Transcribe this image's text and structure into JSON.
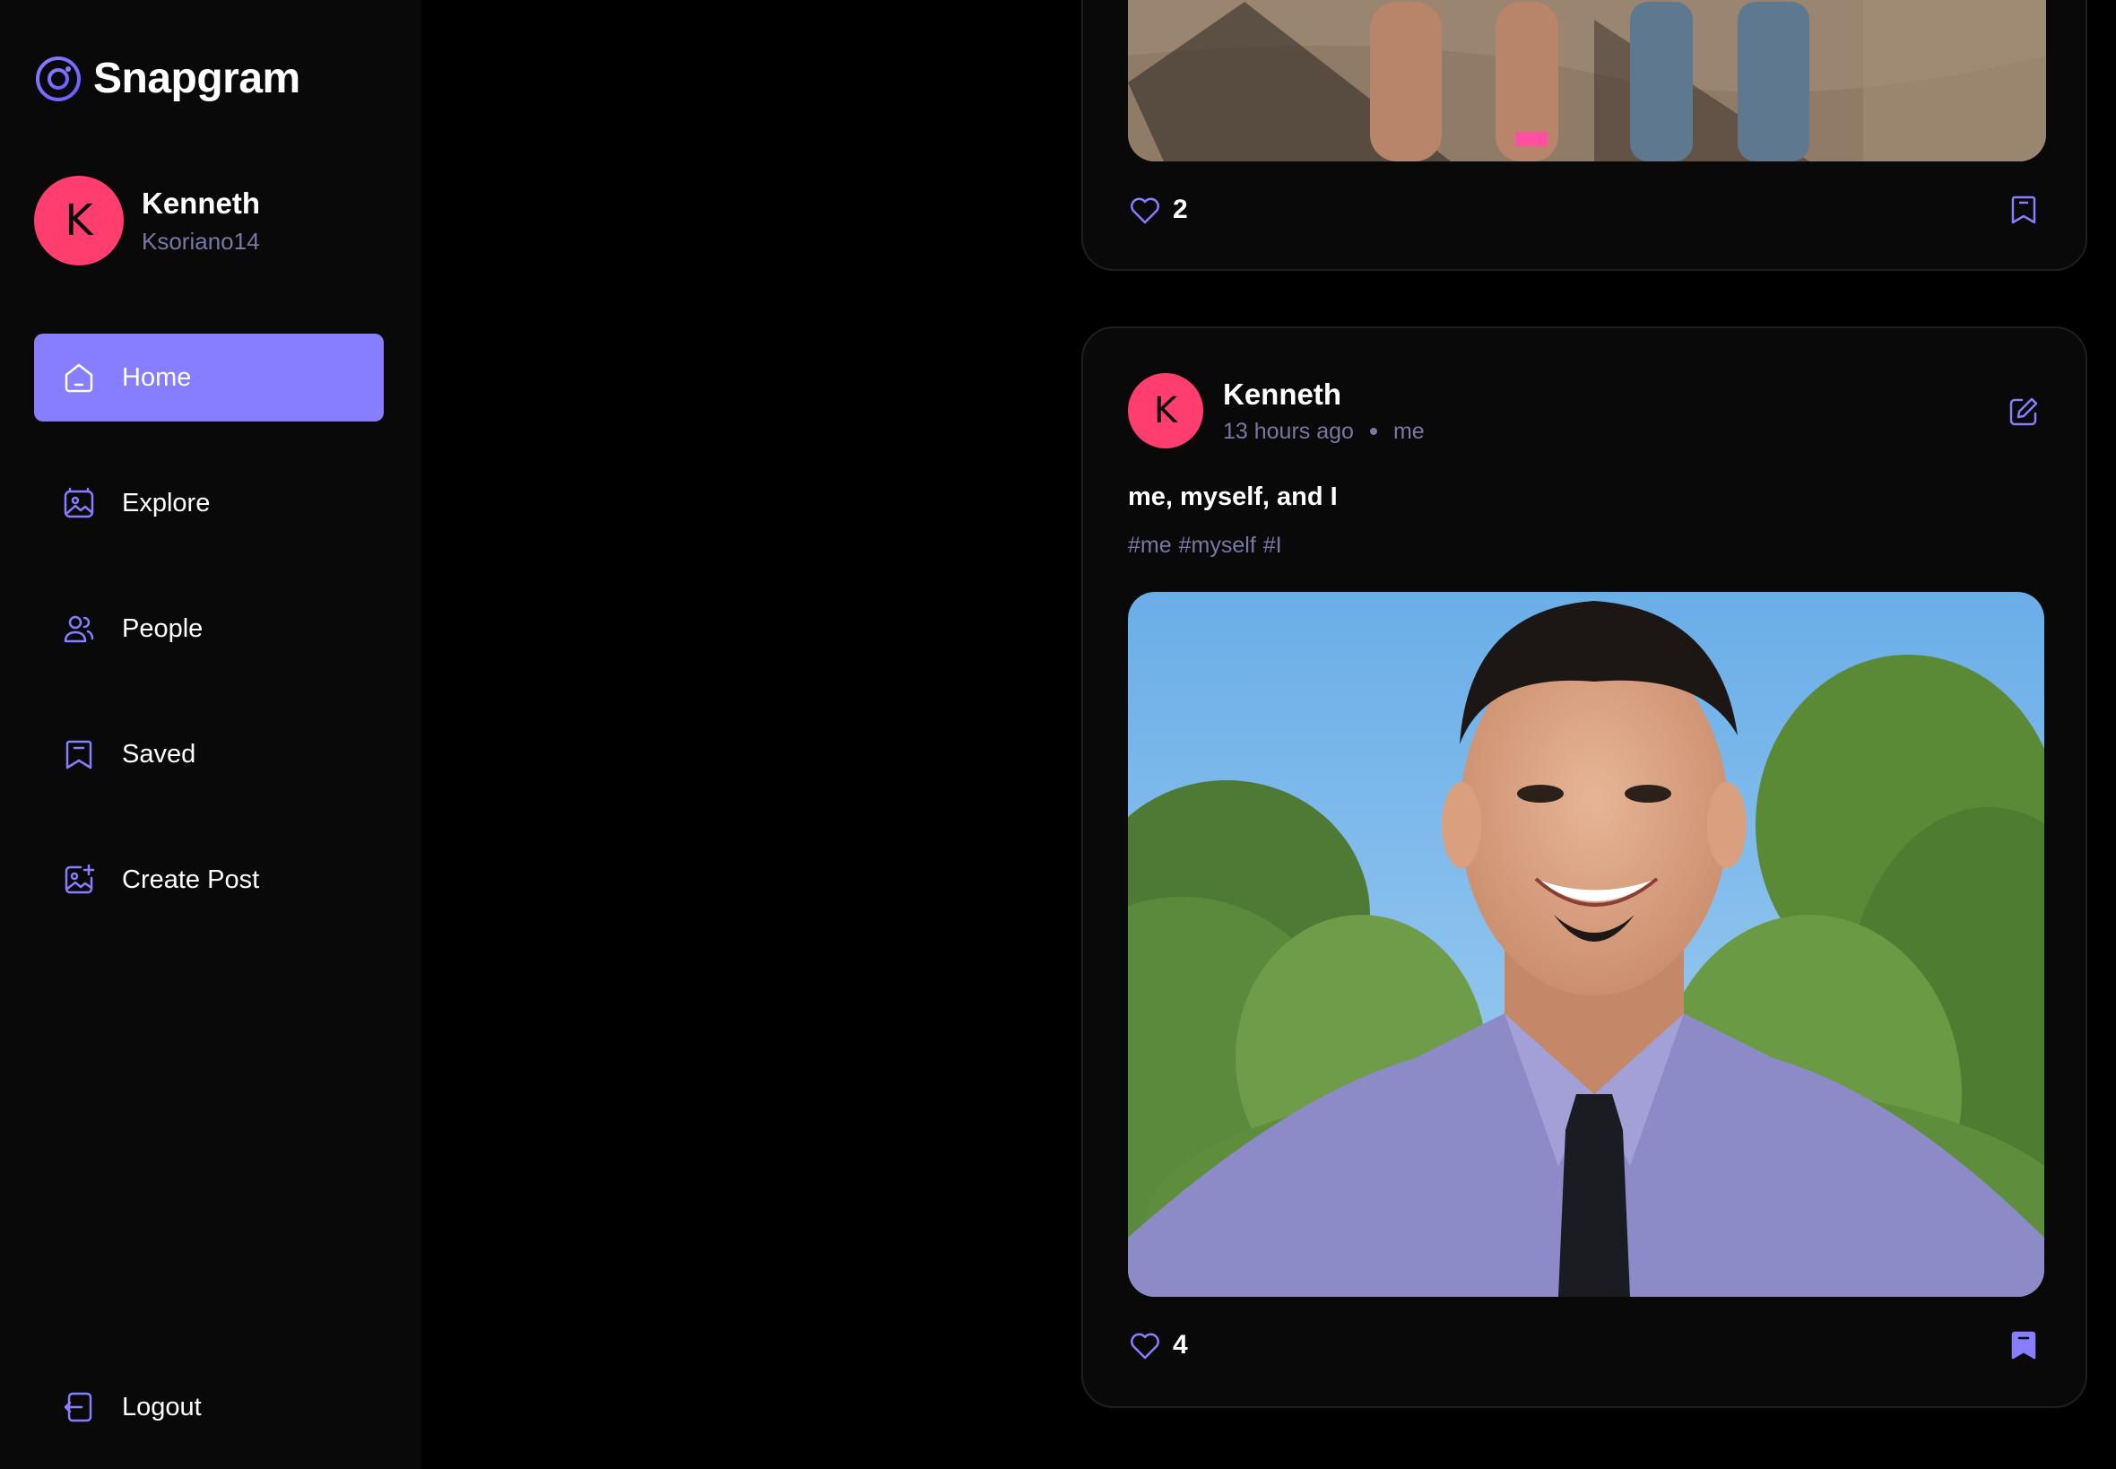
{
  "app": {
    "name": "Snapgram"
  },
  "user": {
    "initial": "K",
    "name": "Kenneth",
    "username": "Ksoriano14"
  },
  "nav": {
    "items": [
      {
        "label": "Home",
        "icon": "home-icon",
        "active": true
      },
      {
        "label": "Explore",
        "icon": "explore-icon",
        "active": false
      },
      {
        "label": "People",
        "icon": "people-icon",
        "active": false
      },
      {
        "label": "Saved",
        "icon": "bookmark-icon",
        "active": false
      },
      {
        "label": "Create Post",
        "icon": "create-post-icon",
        "active": false
      }
    ],
    "logout_label": "Logout"
  },
  "colors": {
    "accent": "#877eff",
    "avatar": "#ff3d6e",
    "muted_text": "#7878a3",
    "sidebar_bg": "#09090a",
    "page_bg": "#000000"
  },
  "feed": {
    "posts": [
      {
        "likes": "2",
        "saved": false
      },
      {
        "author_initial": "K",
        "author": "Kenneth",
        "time": "13 hours ago",
        "location": "me",
        "caption": "me, myself, and I",
        "tags": [
          "#me",
          "#myself",
          "#I"
        ],
        "likes": "4",
        "saved": true
      }
    ]
  }
}
